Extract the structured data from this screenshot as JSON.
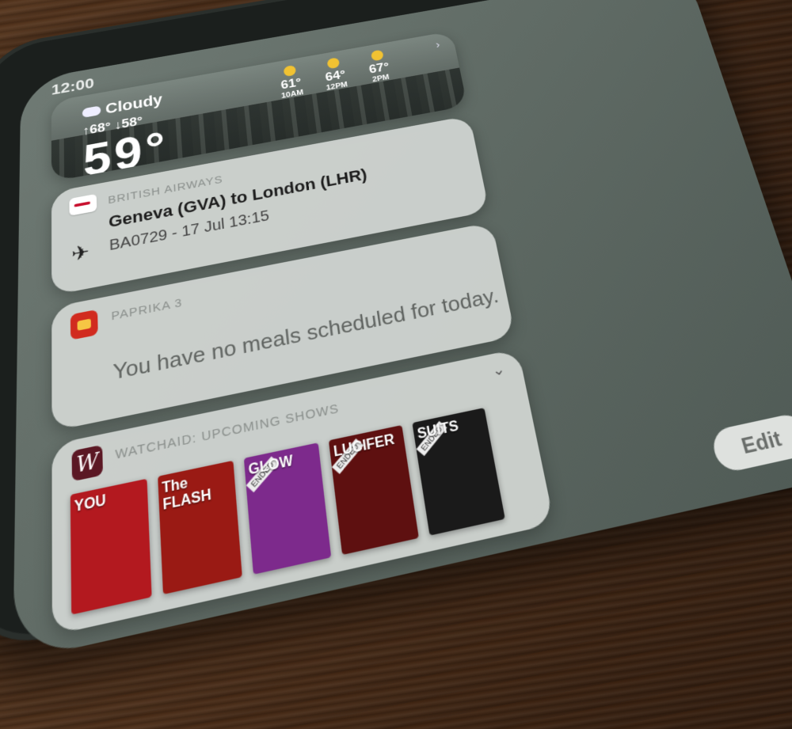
{
  "status_bar": {
    "time": "12:00"
  },
  "weather": {
    "condition": "Cloudy",
    "hilo": "↑68° ↓58°",
    "temperature": "59°",
    "forecast": [
      {
        "temp": "61°",
        "hour": "10AM"
      },
      {
        "temp": "64°",
        "hour": "12PM"
      },
      {
        "temp": "67°",
        "hour": "2PM"
      }
    ]
  },
  "british_airways": {
    "app_name": "BRITISH AIRWAYS",
    "title": "Geneva (GVA) to London (LHR)",
    "subtitle": "BA0729 - 17 Jul 13:15"
  },
  "paprika": {
    "app_name": "PAPRIKA 3",
    "message": "You have no meals scheduled for today."
  },
  "watchaid": {
    "app_name": "WATCHAID: UPCOMING SHOWS",
    "posters": [
      {
        "title": "YOU",
        "badge": "",
        "bg": "#b3191f"
      },
      {
        "title": "The FLASH",
        "badge": "",
        "bg": "#9a1a14"
      },
      {
        "title": "GLOW",
        "badge": "ENDED",
        "bg": "#7d2a8c"
      },
      {
        "title": "LUCIFER",
        "badge": "ENDED",
        "bg": "#5e1010"
      },
      {
        "title": "SUITS",
        "badge": "ENDED",
        "bg": "#1a1a1a"
      }
    ]
  },
  "edit_button": {
    "label": "Edit"
  },
  "colors": {
    "ba_red": "#c8102e",
    "paprika_red": "#d12b1f",
    "watchaid_maroon": "#5b1824"
  },
  "icons": [
    "cloud-icon",
    "sun-icon",
    "plane-icon",
    "chevron-right-icon",
    "chevron-down-icon"
  ]
}
